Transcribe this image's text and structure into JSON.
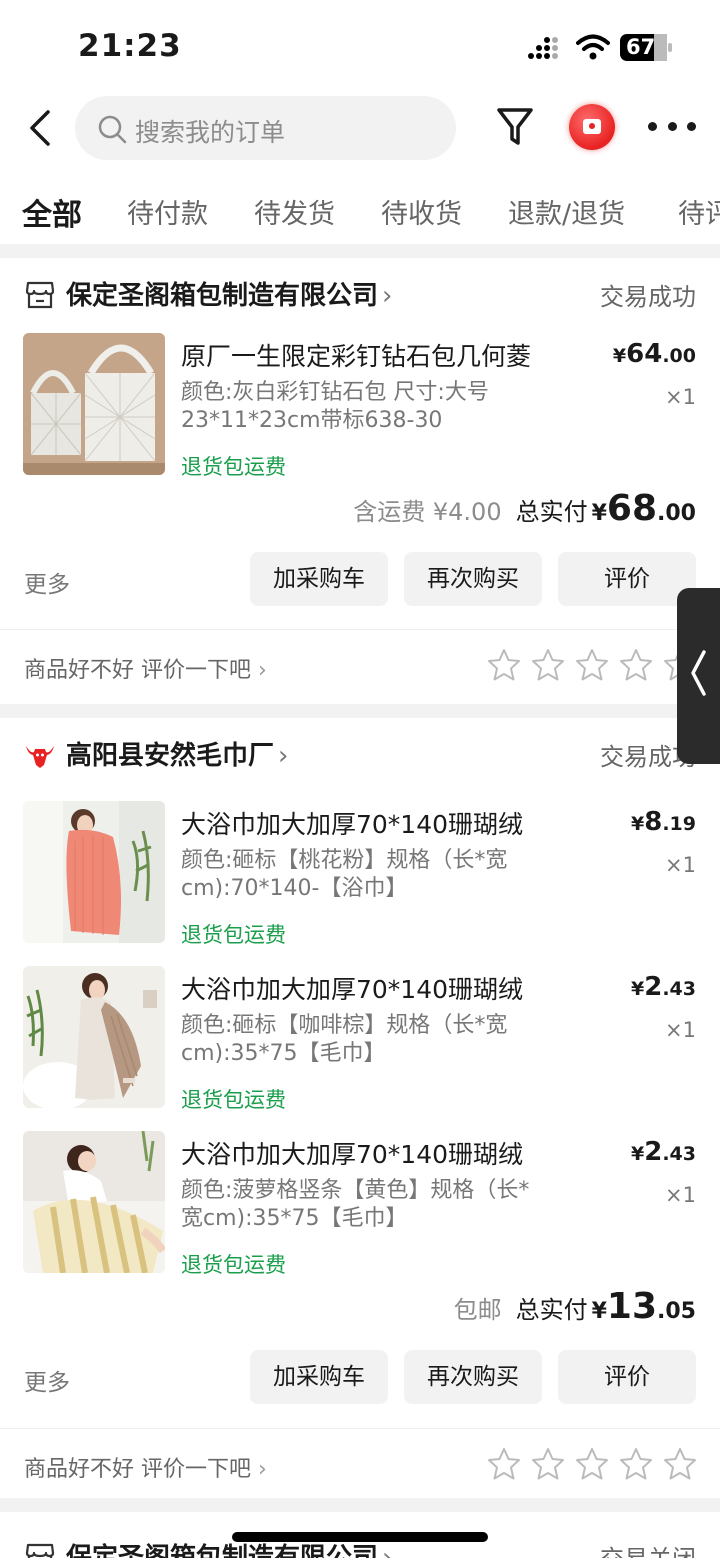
{
  "status_bar": {
    "time": "21:23",
    "battery": "67"
  },
  "search": {
    "placeholder": "搜索我的订单"
  },
  "tabs": [
    {
      "label": "全部",
      "active": true
    },
    {
      "label": "待付款"
    },
    {
      "label": "待发货"
    },
    {
      "label": "待收货"
    },
    {
      "label": "退款/退货"
    },
    {
      "label": "待评"
    }
  ],
  "orders": [
    {
      "shop": "保定圣阁箱包制造有限公司",
      "status": "交易成功",
      "items": [
        {
          "title": "原厂一生限定彩钉钻石包几何菱",
          "spec_line1": "颜色:灰白彩钉钻石包 尺寸:大号",
          "spec_line2": "23*11*23cm带标638-30",
          "return_note": "退货包运费",
          "price_yen": "¥",
          "price_int": "64",
          "price_dec": ".00",
          "qty": "×1"
        }
      ],
      "shipping": "含运费 ¥4.00",
      "total_label": "总实付",
      "total_yen": "¥",
      "total_int": "68",
      "total_dec": ".00",
      "more": "更多",
      "buttons": [
        "加采购车",
        "再次购买",
        "评价"
      ],
      "review_prompt": "商品好不好 评价一下吧"
    },
    {
      "shop": "高阳县安然毛巾厂",
      "status": "交易成功",
      "items": [
        {
          "title": "大浴巾加大加厚70*140珊瑚绒",
          "spec_line1": "颜色:砸标【桃花粉】规格（长*宽",
          "spec_line2": "cm):70*140-【浴巾】",
          "return_note": "退货包运费",
          "price_yen": "¥",
          "price_int": "8",
          "price_dec": ".19",
          "qty": "×1"
        },
        {
          "title": "大浴巾加大加厚70*140珊瑚绒",
          "spec_line1": "颜色:砸标【咖啡棕】规格（长*宽",
          "spec_line2": "cm):35*75【毛巾】",
          "return_note": "退货包运费",
          "price_yen": "¥",
          "price_int": "2",
          "price_dec": ".43",
          "qty": "×1"
        },
        {
          "title": "大浴巾加大加厚70*140珊瑚绒",
          "spec_line1": "颜色:菠萝格竖条【黄色】规格（长*",
          "spec_line2": "宽cm):35*75【毛巾】",
          "return_note": "退货包运费",
          "price_yen": "¥",
          "price_int": "2",
          "price_dec": ".43",
          "qty": "×1"
        }
      ],
      "shipping": "包邮",
      "total_label": "总实付",
      "total_yen": "¥",
      "total_int": "13",
      "total_dec": ".05",
      "more": "更多",
      "buttons": [
        "加采购车",
        "再次购买",
        "评价"
      ],
      "review_prompt": "商品好不好 评价一下吧"
    },
    {
      "shop": "保定圣阁箱包制造有限公司",
      "status": "交易关闭"
    }
  ],
  "colors": {
    "accent_green": "#1a9e4b",
    "brand_red": "#e82222"
  }
}
